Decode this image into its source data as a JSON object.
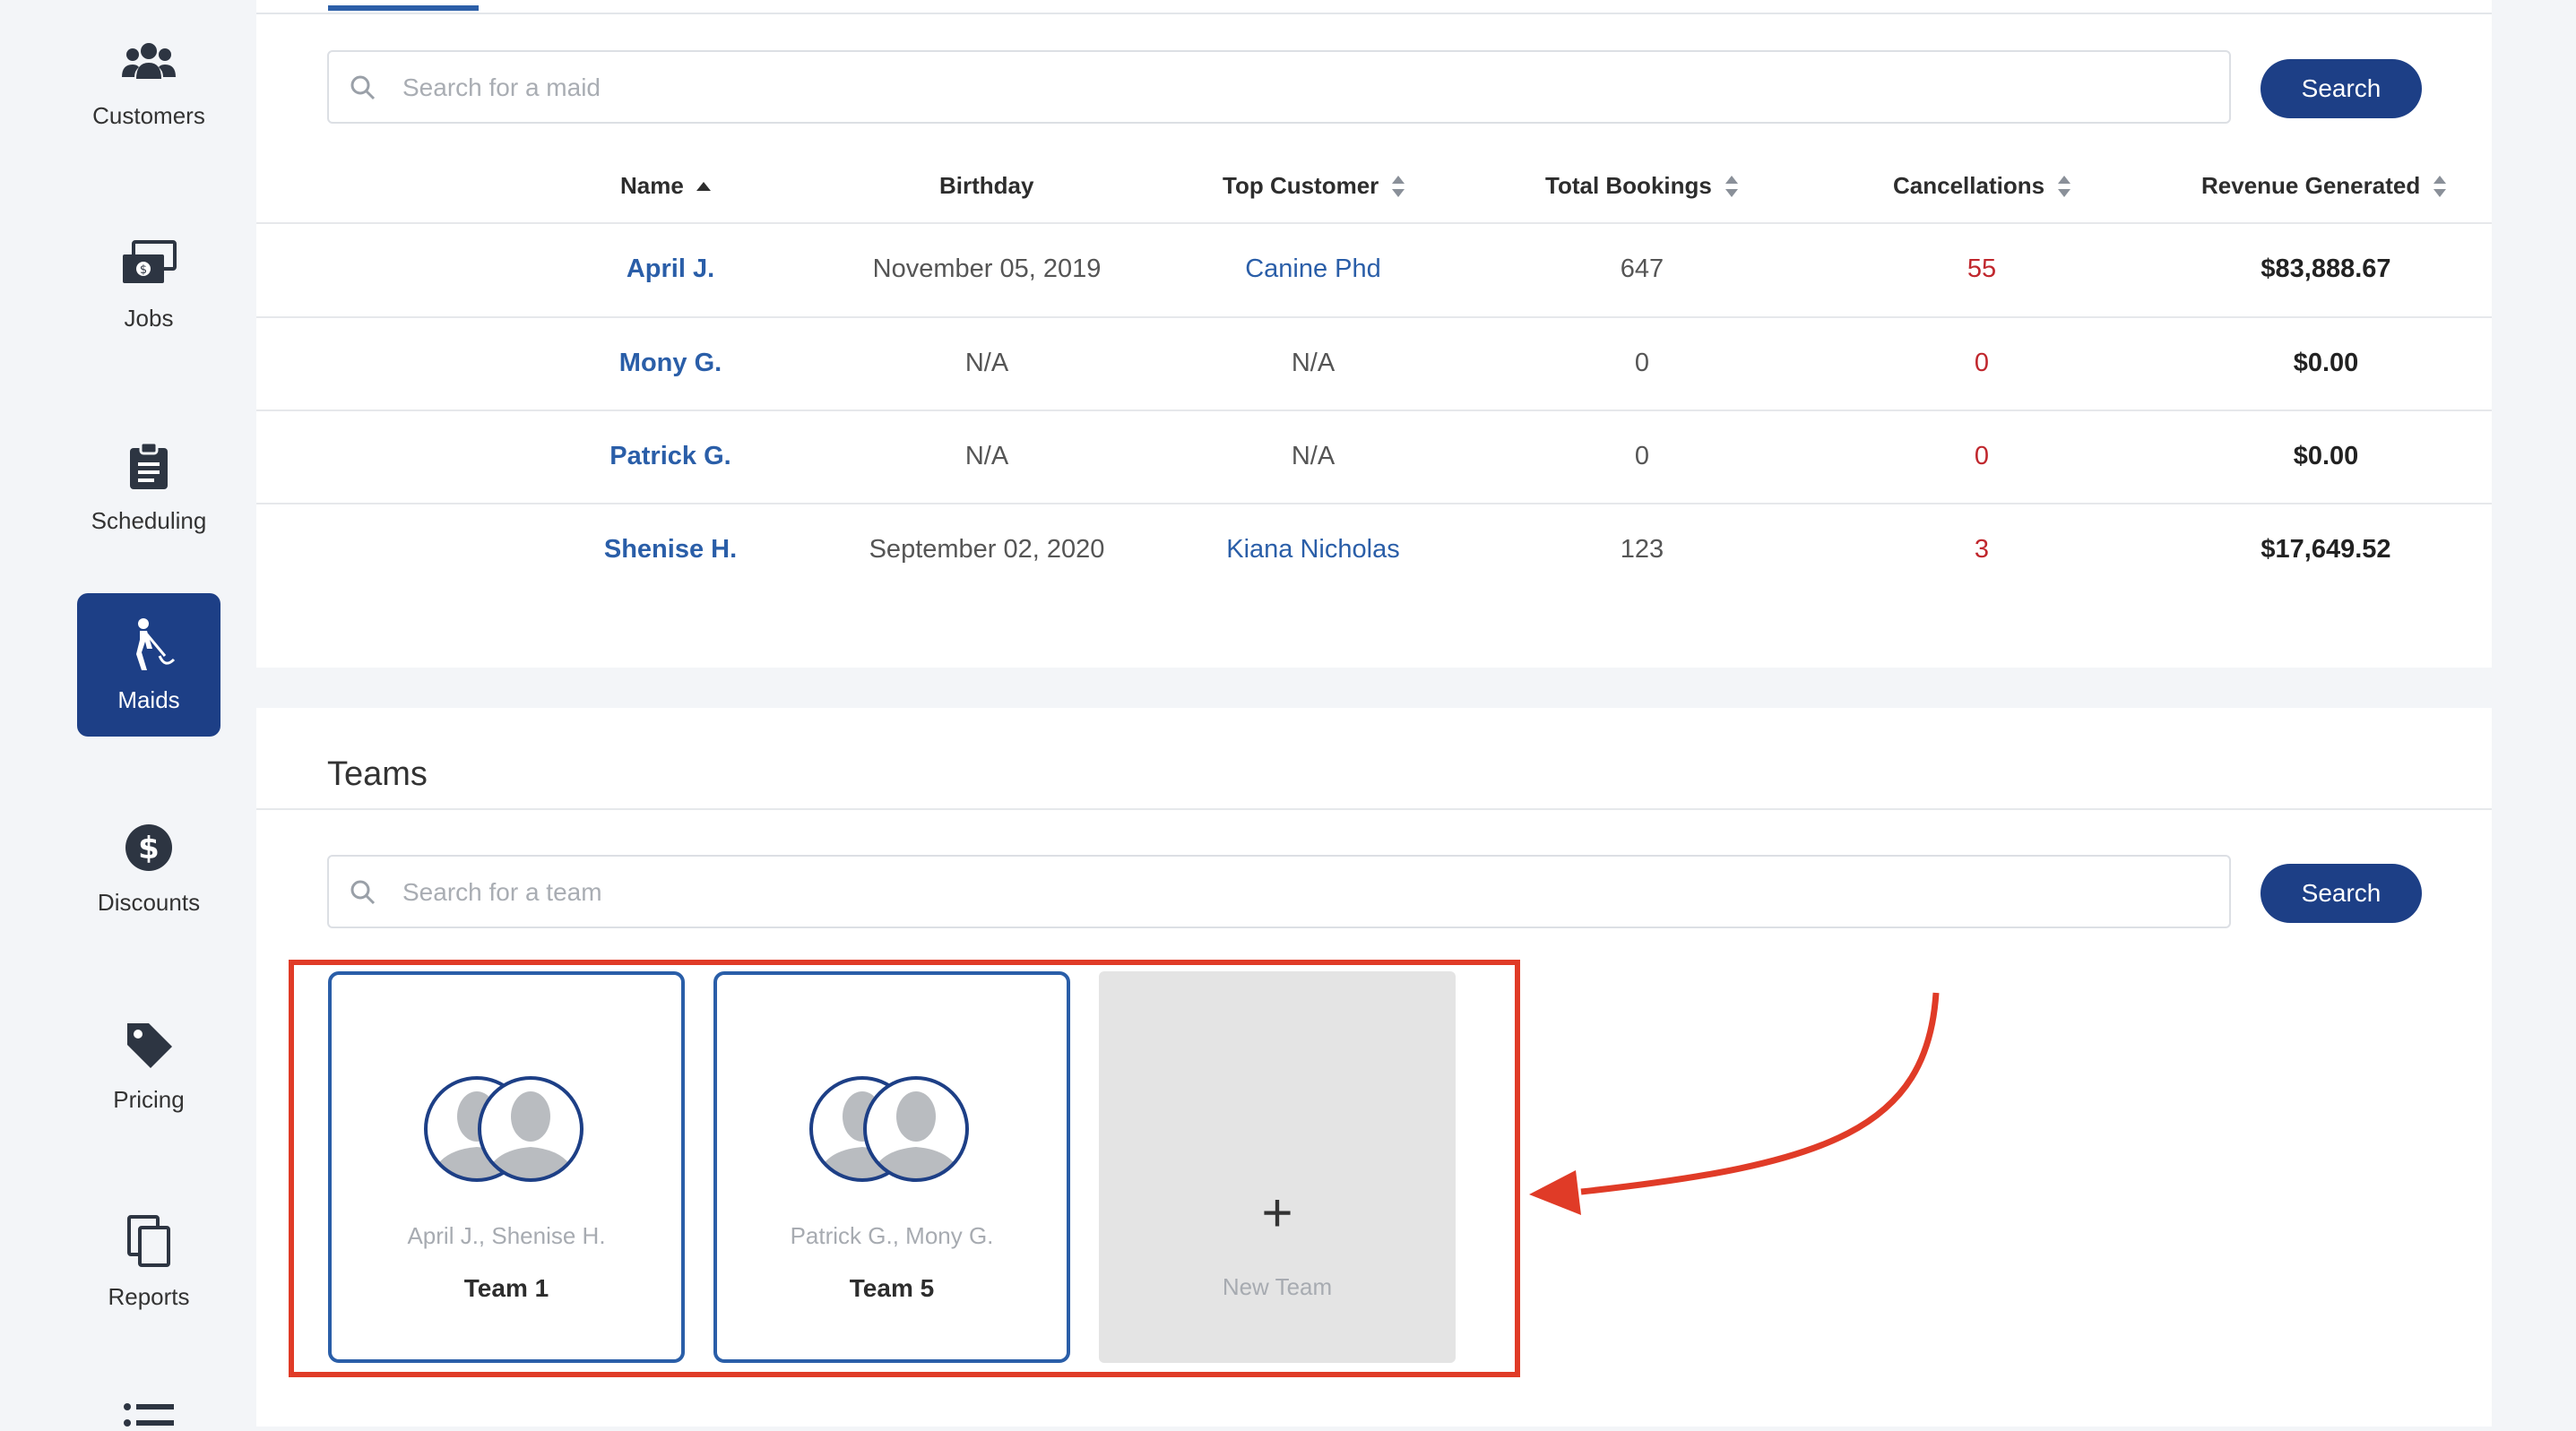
{
  "sidebar": {
    "items": [
      {
        "label": "Customers",
        "icon": "users-icon"
      },
      {
        "label": "Jobs",
        "icon": "money-icon"
      },
      {
        "label": "Scheduling",
        "icon": "clipboard-icon"
      },
      {
        "label": "Maids",
        "icon": "maid-icon",
        "active": true
      },
      {
        "label": "Discounts",
        "icon": "dollar-circle-icon"
      },
      {
        "label": "Pricing",
        "icon": "tag-icon"
      },
      {
        "label": "Reports",
        "icon": "copy-icon"
      }
    ]
  },
  "maids": {
    "search_placeholder": "Search for a maid",
    "search_button": "Search",
    "columns": [
      "Name",
      "Birthday",
      "Top Customer",
      "Total Bookings",
      "Cancellations",
      "Revenue Generated"
    ],
    "rows": [
      {
        "name": "April J.",
        "birthday": "November 05, 2019",
        "top_customer": "Canine Phd",
        "total_bookings": "647",
        "cancellations": "55",
        "revenue": "$83,888.67"
      },
      {
        "name": "Mony G.",
        "birthday": "N/A",
        "top_customer": "N/A",
        "total_bookings": "0",
        "cancellations": "0",
        "revenue": "$0.00"
      },
      {
        "name": "Patrick G.",
        "birthday": "N/A",
        "top_customer": "N/A",
        "total_bookings": "0",
        "cancellations": "0",
        "revenue": "$0.00"
      },
      {
        "name": "Shenise H.",
        "birthday": "September 02, 2020",
        "top_customer": "Kiana Nicholas",
        "total_bookings": "123",
        "cancellations": "3",
        "revenue": "$17,649.52"
      }
    ]
  },
  "teams": {
    "title": "Teams",
    "search_placeholder": "Search for a team",
    "search_button": "Search",
    "cards": [
      {
        "members": "April J., Shenise H.",
        "name": "Team 1"
      },
      {
        "members": "Patrick G., Mony G.",
        "name": "Team 5"
      }
    ],
    "new_team_plus": "+",
    "new_team_label": "New Team"
  },
  "colors": {
    "primary": "#1d3f86",
    "link": "#2a5ea8",
    "cancellation": "#c0272d",
    "annotation": "#e03b27"
  }
}
